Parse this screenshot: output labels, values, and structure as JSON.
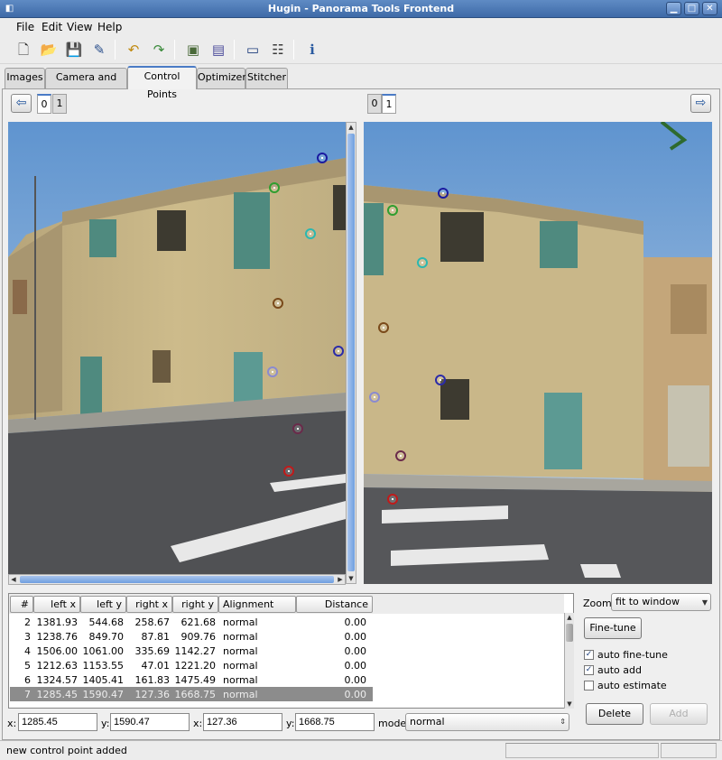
{
  "window": {
    "title": "Hugin - Panorama Tools Frontend"
  },
  "menu": [
    "File",
    "Edit",
    "View",
    "Help"
  ],
  "tabs": [
    "Images",
    "Camera and Lens",
    "Control Points",
    "Optimizer",
    "Stitcher"
  ],
  "active_tab": "Control Points",
  "left_image": {
    "tabs": [
      "0",
      "1"
    ],
    "active": "0"
  },
  "right_image": {
    "tabs": [
      "0",
      "1"
    ],
    "active": "1"
  },
  "control_point_colors": {
    "2": "#1a1aa0",
    "3": "#2f9e2f",
    "4": "#2bb8b0",
    "5": "#7a4a1a",
    "6": "#2b2ba8",
    "7": "#8a8ad0",
    "8": "#6a2a4a",
    "9": "#c01a1a"
  },
  "table": {
    "headers": [
      "#",
      "left x",
      "left y",
      "right x",
      "right y",
      "Alignment",
      "Distance"
    ],
    "rows": [
      {
        "n": "2",
        "lx": "1381.93",
        "ly": "544.68",
        "rx": "258.67",
        "ry": "621.68",
        "align": "normal",
        "dist": "0.00"
      },
      {
        "n": "3",
        "lx": "1238.76",
        "ly": "849.70",
        "rx": "87.81",
        "ry": "909.76",
        "align": "normal",
        "dist": "0.00"
      },
      {
        "n": "4",
        "lx": "1506.00",
        "ly": "1061.00",
        "rx": "335.69",
        "ry": "1142.27",
        "align": "normal",
        "dist": "0.00"
      },
      {
        "n": "5",
        "lx": "1212.63",
        "ly": "1153.55",
        "rx": "47.01",
        "ry": "1221.20",
        "align": "normal",
        "dist": "0.00"
      },
      {
        "n": "6",
        "lx": "1324.57",
        "ly": "1405.41",
        "rx": "161.83",
        "ry": "1475.49",
        "align": "normal",
        "dist": "0.00"
      },
      {
        "n": "7",
        "lx": "1285.45",
        "ly": "1590.47",
        "rx": "127.36",
        "ry": "1668.75",
        "align": "normal",
        "dist": "0.00"
      }
    ],
    "selected": "7"
  },
  "edit": {
    "x_label": "x:",
    "y_label": "y:",
    "left_x": "1285.45",
    "left_y": "1590.47",
    "right_x": "127.36",
    "right_y": "1668.75",
    "mode_label": "mode:",
    "mode_value": "normal"
  },
  "controls": {
    "zoom_label": "Zoom:",
    "zoom_value": "fit to window",
    "finetune_label": "Fine-tune",
    "auto_finetune": {
      "label": "auto fine-tune",
      "checked": true
    },
    "auto_add": {
      "label": "auto add",
      "checked": true
    },
    "auto_estimate": {
      "label": "auto estimate",
      "checked": false
    },
    "delete_label": "Delete",
    "add_label": "Add"
  },
  "status": {
    "text": "new control point added"
  }
}
